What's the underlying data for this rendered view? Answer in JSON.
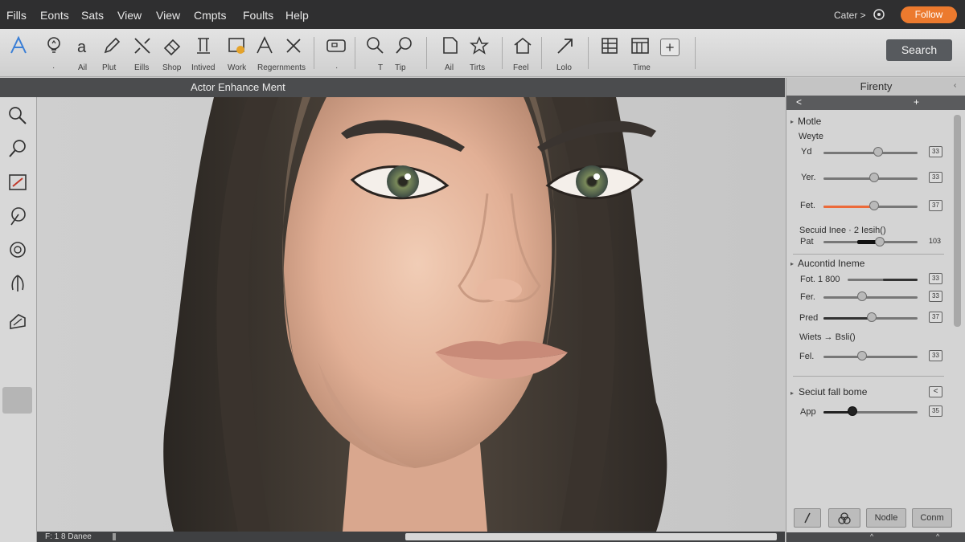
{
  "menubar": {
    "items": [
      "Fills",
      "Eonts",
      "Sats",
      "View",
      "View",
      "Cmpts",
      "Foults",
      "Help"
    ],
    "right_text": "Cater >",
    "follow_label": "Follow"
  },
  "toolbar": {
    "items": [
      {
        "icon": "text-a-icon",
        "label": ""
      },
      {
        "icon": "lightbulb-icon",
        "label": "·"
      },
      {
        "icon": "letter-a-icon",
        "label": "Ail"
      },
      {
        "icon": "pencil-icon",
        "label": "Plut"
      },
      {
        "icon": "wand-icon",
        "label": "Eills"
      },
      {
        "icon": "eraser-icon",
        "label": "Shop"
      },
      {
        "icon": "stamp-icon",
        "label": "Intived"
      },
      {
        "icon": "badge-icon",
        "label": "Work"
      },
      {
        "icon": "letter-a-outline-icon",
        "label": "Regernments"
      },
      {
        "icon": "close-x-icon",
        "label": ""
      },
      {
        "icon": "frame-icon",
        "label": "·"
      },
      {
        "icon": "magnify-icon",
        "label": "T"
      },
      {
        "icon": "magnify-alt-icon",
        "label": "Tip"
      },
      {
        "icon": "square-icon",
        "label": "Ail"
      },
      {
        "icon": "star-icon",
        "label": "Tirts"
      },
      {
        "icon": "home-icon",
        "label": "Feel"
      },
      {
        "icon": "arrow-up-right-icon",
        "label": "Lolo"
      },
      {
        "icon": "grid-icon",
        "label": ""
      },
      {
        "icon": "window-icon",
        "label": "Time"
      },
      {
        "icon": "plus-icon",
        "label": ""
      }
    ],
    "search_label": "Search"
  },
  "canvas": {
    "title": "Actor Enhance Ment",
    "status": "F: 1 8 Danee"
  },
  "panel": {
    "title": "Firenty",
    "nav_left": "<",
    "nav_right": "+",
    "section1": {
      "heading": "Motle",
      "sub": "Weyte",
      "rows": [
        {
          "label": "Yd",
          "value": "33",
          "level": 0.6
        },
        {
          "label": "Yer.",
          "value": "33",
          "level": 0.54
        },
        {
          "label": "Fet.",
          "value": "37",
          "level": 0.54
        }
      ],
      "sub2": "Secuid Inee · 2 Iesih()",
      "row4": {
        "label": "Pat",
        "value": "103",
        "level": 0.6
      }
    },
    "section2": {
      "heading": "Aucontid Ineme",
      "rows": [
        {
          "label": "Fot. 1 800",
          "value": "33",
          "level": 0.7
        },
        {
          "label": "Fer.",
          "value": "33",
          "level": 0.4
        },
        {
          "label": "Pred",
          "value": "37",
          "level": 0.55
        }
      ],
      "sub": "Wiets → Bsli()",
      "row4": {
        "label": "Fel.",
        "value": "33",
        "level": 0.4
      }
    },
    "section3": {
      "heading": "Seciut fall bome",
      "head_button": "<",
      "row": {
        "label": "App",
        "value": "35",
        "level": 0.28
      }
    },
    "buttons": {
      "node": "Nodle",
      "confirm": "Conm"
    },
    "bottom_left": "^",
    "bottom_right": "^"
  },
  "colors": {
    "accent": "#ec7a2e",
    "menubar": "#2f2f30",
    "slider_active": "#ec6a3a"
  }
}
